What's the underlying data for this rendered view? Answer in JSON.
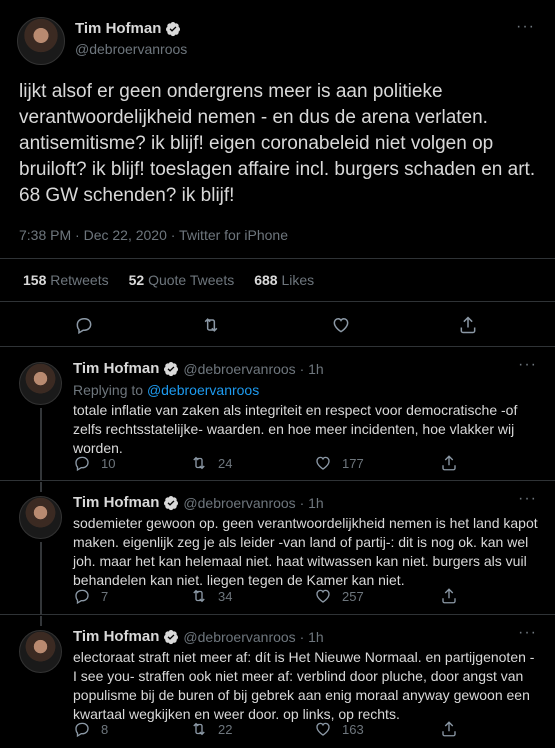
{
  "main": {
    "name": "Tim Hofman",
    "handle": "@debroervanroos",
    "more": "···",
    "text": "lijkt alsof er geen ondergrens meer is aan politieke verantwoordelijkheid nemen - en dus de arena verlaten. antisemitisme? ik blijf! eigen coronabeleid niet volgen op bruiloft? ik blijf! toeslagen affaire incl. burgers schaden en art. 68 GW schenden? ik blijf!",
    "meta": "7:38 PM · Dec 22, 2020 · Twitter for iPhone",
    "retweets_count": "158",
    "retweets_label": "Retweets",
    "quotes_count": "52",
    "quotes_label": "Quote Tweets",
    "likes_count": "688",
    "likes_label": "Likes"
  },
  "replies": [
    {
      "name": "Tim Hofman",
      "handle_time": "@debroervanroos · 1h",
      "replying_prefix": "Replying to",
      "replying_to": "@debroervanroos",
      "text": "totale inflatie van zaken als integriteit en respect voor democratische -of zelfs rechtsstatelijke- waarden. en hoe meer incidenten, hoe vlakker wij worden.",
      "reply_count": "10",
      "retweet_count": "24",
      "like_count": "177"
    },
    {
      "name": "Tim Hofman",
      "handle_time": "@debroervanroos · 1h",
      "text": "sodemieter gewoon op. geen verantwoordelijkheid nemen is het land kapot maken. eigenlijk zeg je als leider -van land of partij-: dit is nog ok. kan wel joh. maar het kan helemaal niet. haat witwassen kan niet. burgers als vuil behandelen kan niet. liegen tegen de Kamer kan niet.",
      "reply_count": "7",
      "retweet_count": "34",
      "like_count": "257"
    },
    {
      "name": "Tim Hofman",
      "handle_time": "@debroervanroos · 1h",
      "text": "electoraat straft niet meer af: dít is Het Nieuwe Normaal. en partijgenoten -I see you- straffen ook niet meer af: verblind door pluche, door angst van populisme bij de buren of bij gebrek aan enig moraal anyway gewoon een kwartaal wegkijken en weer door. op links, op rechts.",
      "reply_count": "8",
      "retweet_count": "22",
      "like_count": "163"
    }
  ],
  "colors": {
    "accent": "#1d9bf0",
    "muted": "#6e767d",
    "background": "#000000"
  }
}
